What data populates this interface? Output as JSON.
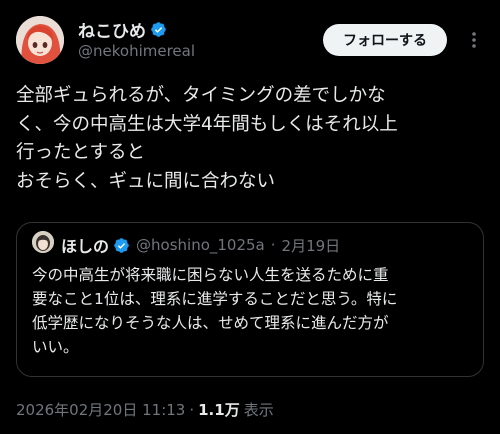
{
  "author": {
    "display_name": "ねこひめ",
    "handle": "@nekohimereal",
    "verified": true,
    "avatar_icon": "avatar-icon"
  },
  "actions": {
    "follow_label": "フォローする",
    "more_icon": "more-icon"
  },
  "tweet": {
    "lines": [
      "全部ギュられるが、タイミングの差でしかな",
      "く、今の中高生は大学4年間もしくはそれ以上",
      "行ったとすると",
      "おそらく、ギュに間に合わない"
    ]
  },
  "quote": {
    "display_name": "ほしの",
    "verified": true,
    "handle": "@hoshino_1025a",
    "separator": "·",
    "date": "2月19日",
    "lines": [
      "今の中高生が将来職に困らない人生を送るために重",
      "要なこと1位は、理系に進学することだと思う。特に",
      "低学歴になりそうな人は、せめて理系に進んだ方が",
      "いい。"
    ]
  },
  "footer": {
    "timestamp": "2026年02月20日 11:13",
    "separator": "·",
    "views_count": "1.1万",
    "views_label": "表示"
  },
  "colors": {
    "background": "#000000",
    "text": "#e7e9ea",
    "muted": "#71767b",
    "verified": "#1d9bf0",
    "border": "#2f3336"
  }
}
